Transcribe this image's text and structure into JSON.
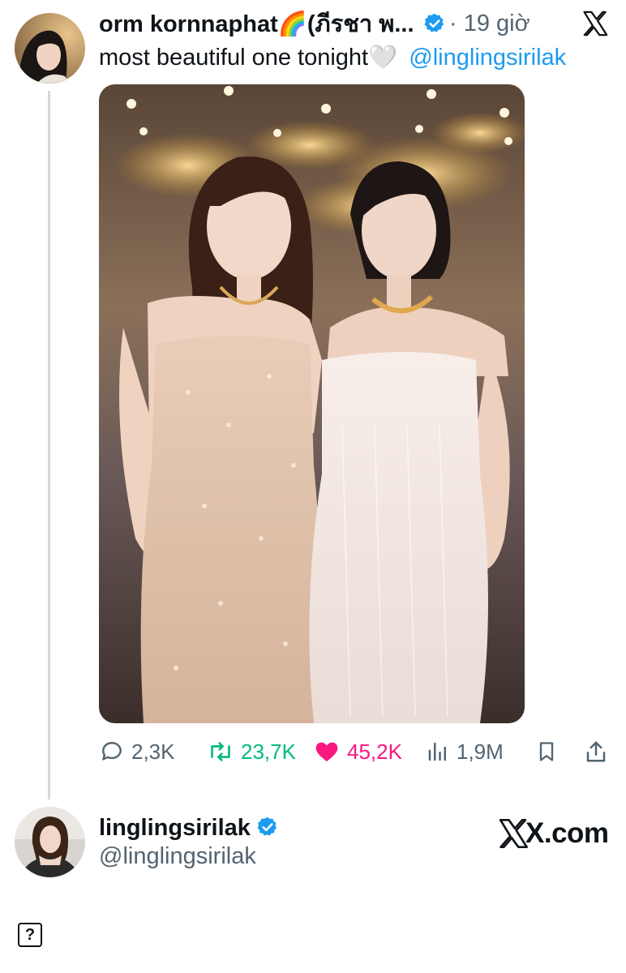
{
  "tweet": {
    "author_name": "orm kornnaphat🌈(ภีรชา พ...",
    "time": "· 19 giờ",
    "text": "most beautiful one tonight🤍",
    "mention": "@linglingsirilak"
  },
  "actions": {
    "replies": "2,3K",
    "retweets": "23,7K",
    "likes": "45,2K",
    "views": "1,9M"
  },
  "quoted": {
    "name": "linglingsirilak",
    "handle": "@linglingsirilak",
    "site": "X.com"
  },
  "footer": {
    "help_glyph": "?"
  },
  "colors": {
    "accent": "#1d9bf0",
    "retweet": "#00ba7c",
    "like": "#f91880",
    "muted": "#536471"
  }
}
